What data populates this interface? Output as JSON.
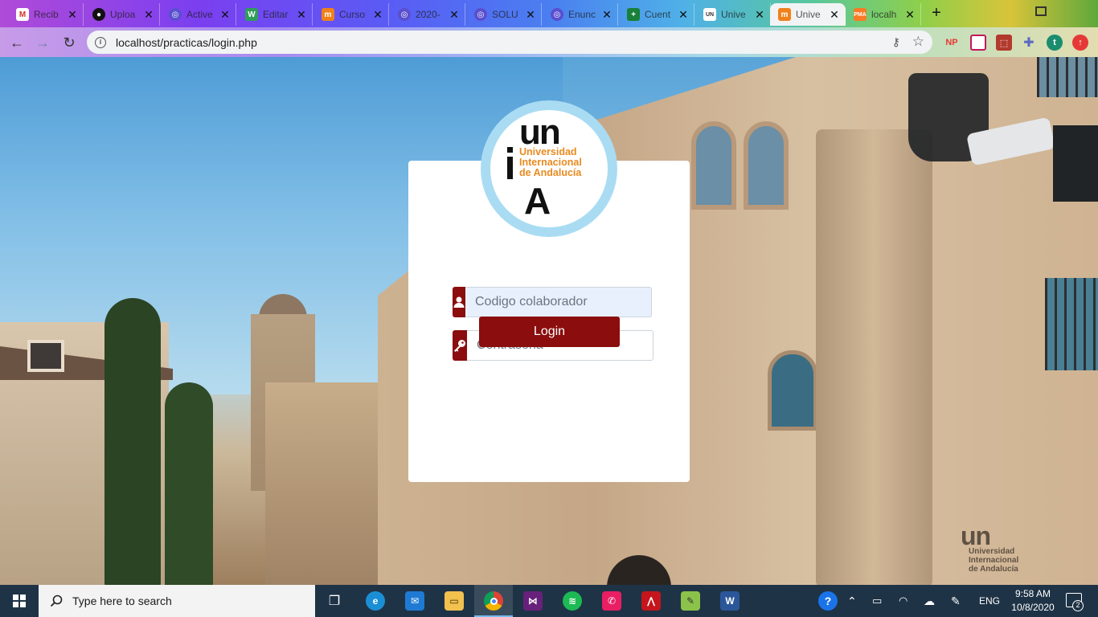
{
  "browser": {
    "tabs": [
      {
        "label": "Recib",
        "favicon": "gmail-icon",
        "color": "#d93025"
      },
      {
        "label": "Uploa",
        "favicon": "github-icon",
        "color": "#111111"
      },
      {
        "label": "Active",
        "favicon": "globe-icon",
        "color": "#5a4fcf"
      },
      {
        "label": "Editar",
        "favicon": "wolf-icon",
        "color": "#2e9d5b"
      },
      {
        "label": "Curso",
        "favicon": "moodle-icon",
        "color": "#f0811a"
      },
      {
        "label": "2020-",
        "favicon": "globe-icon",
        "color": "#5a4fcf"
      },
      {
        "label": "SOLU",
        "favicon": "globe-icon",
        "color": "#5a4fcf"
      },
      {
        "label": "Enunc",
        "favicon": "globe-icon",
        "color": "#5a4fcf"
      },
      {
        "label": "Cuent",
        "favicon": "sheets-plus-icon",
        "color": "#188038"
      },
      {
        "label": "Unive",
        "favicon": "unia-icon",
        "color": "#ffffff"
      },
      {
        "label": "Unive",
        "favicon": "moodle-icon",
        "color": "#f0811a"
      },
      {
        "label": "localh",
        "favicon": "xampp-icon",
        "color": "#fb7a24"
      }
    ],
    "active_tab_index": 10,
    "url": "localhost/practicas/login.php",
    "extensions": [
      {
        "label": "NP",
        "color": "#e53935"
      },
      {
        "label": "",
        "color": "#c2185b"
      },
      {
        "label": "",
        "color": "#b23a2d"
      },
      {
        "label": "",
        "color": "#5c6bc0"
      },
      {
        "label": "t",
        "color": "#1a8d6f"
      },
      {
        "label": "",
        "color": "#e53935"
      }
    ]
  },
  "login": {
    "logo": {
      "top": "un",
      "name_lines": [
        "Universidad",
        "Internacional",
        "de Andalucía"
      ],
      "bottom": "A",
      "accent": "#e88b21",
      "ring": "#a9dcf3"
    },
    "user_placeholder": "Codigo colaborador",
    "password_placeholder": "Contraseña",
    "button_label": "Login",
    "accent_color": "#8b0d0d"
  },
  "background_watermark": {
    "top": "un",
    "lines": [
      "Universidad",
      "Internacional",
      "de Andalucía"
    ]
  },
  "taskbar": {
    "search_placeholder": "Type here to search",
    "apps": [
      "task-view-icon",
      "edge-icon",
      "mail-icon",
      "file-explorer-icon",
      "chrome-icon",
      "visual-studio-icon",
      "spotify-icon",
      "whatsapp-icon",
      "acrobat-icon",
      "notepad-plus-icon",
      "word-icon"
    ],
    "language": "ENG",
    "time": "9:58 AM",
    "date": "10/8/2020",
    "notifications": "2"
  }
}
